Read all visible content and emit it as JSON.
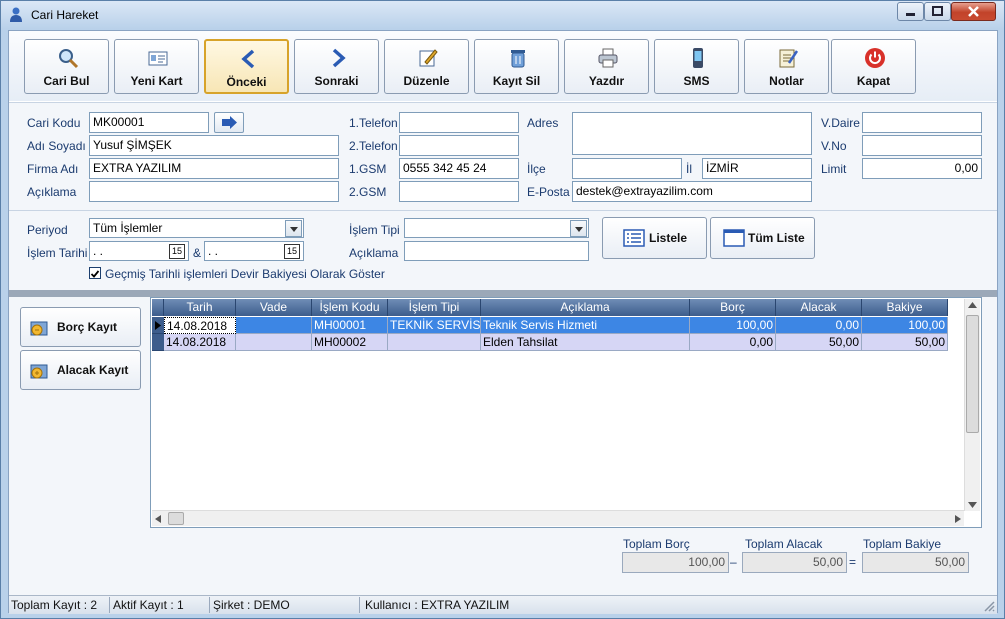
{
  "window": {
    "title": "Cari Hareket"
  },
  "colors": {
    "window_frame": "#b9d1ea",
    "grid_header": "#3d5d8c",
    "selected_row": "#3d86e4",
    "alt_row": "#d6d6f5",
    "active_button_border": "#d7a32a"
  },
  "toolbar": [
    {
      "label": "Cari Bul",
      "icon": "search-icon"
    },
    {
      "label": "Yeni Kart",
      "icon": "new-card-icon"
    },
    {
      "label": "Önceki",
      "icon": "previous-arrow-icon",
      "active": true
    },
    {
      "label": "Sonraki",
      "icon": "next-arrow-icon"
    },
    {
      "label": "Düzenle",
      "icon": "edit-icon"
    },
    {
      "label": "Kayıt Sil",
      "icon": "delete-icon"
    },
    {
      "label": "Yazdır",
      "icon": "printer-icon"
    },
    {
      "label": "SMS",
      "icon": "phone-icon"
    },
    {
      "label": "Notlar",
      "icon": "notes-icon"
    },
    {
      "label": "Kapat",
      "icon": "power-icon"
    }
  ],
  "info": {
    "cari_kodu": {
      "label": "Cari Kodu",
      "value": "MK00001"
    },
    "adi_soyadi": {
      "label": "Adı Soyadı",
      "value": "Yusuf ŞİMŞEK"
    },
    "firma_adi": {
      "label": "Firma Adı",
      "value": "EXTRA YAZILIM"
    },
    "aciklama": {
      "label": "Açıklama",
      "value": ""
    },
    "telefon1": {
      "label": "1.Telefon",
      "value": ""
    },
    "telefon2": {
      "label": "2.Telefon",
      "value": ""
    },
    "gsm1": {
      "label": "1.GSM",
      "value": "0555 342 45 24"
    },
    "gsm2": {
      "label": "2.GSM",
      "value": ""
    },
    "adres": {
      "label": "Adres",
      "value": ""
    },
    "ilce": {
      "label": "İlçe",
      "value": ""
    },
    "il": {
      "label": "İl",
      "value": "İZMİR"
    },
    "eposta": {
      "label": "E-Posta",
      "value": "destek@extrayazilim.com"
    },
    "vdaire": {
      "label": "V.Daire",
      "value": ""
    },
    "vno": {
      "label": "V.No",
      "value": ""
    },
    "limit": {
      "label": "Limit",
      "value": "0,00"
    }
  },
  "filter": {
    "periyod": {
      "label": "Periyod",
      "value": "Tüm İşlemler"
    },
    "islem_tarihi": {
      "label": "İşlem Tarihi",
      "from": " .  .",
      "to": " .  .",
      "separator": "&"
    },
    "islem_tipi": {
      "label": "İşlem Tipi",
      "value": ""
    },
    "aciklama": {
      "label": "Açıklama",
      "value": ""
    },
    "devir_checkbox": {
      "label": "Geçmiş Tarihli işlemleri Devir Bakiyesi Olarak Göster",
      "checked": true
    },
    "listele_label": "Listele",
    "tum_liste_label": "Tüm Liste"
  },
  "side_buttons": {
    "borc_kayit": "Borç Kayıt",
    "alacak_kayit": "Alacak Kayıt"
  },
  "grid": {
    "columns": [
      "Tarih",
      "Vade",
      "İşlem Kodu",
      "İşlem Tipi",
      "Açıklama",
      "Borç",
      "Alacak",
      "Bakiye"
    ],
    "rows": [
      {
        "tarih": "14.08.2018",
        "vade": "",
        "kod": "MH00001",
        "tip": "TEKNİK SERVİS",
        "aciklama": "Teknik Servis Hizmeti",
        "borc": "100,00",
        "alacak": "0,00",
        "bakiye": "100,00",
        "selected": true
      },
      {
        "tarih": "14.08.2018",
        "vade": "",
        "kod": "MH00002",
        "tip": "",
        "aciklama": "Elden Tahsilat",
        "borc": "0,00",
        "alacak": "50,00",
        "bakiye": "50,00",
        "selected": false
      }
    ]
  },
  "totals": {
    "borc": {
      "label": "Toplam Borç",
      "value": "100,00"
    },
    "alacak": {
      "label": "Toplam Alacak",
      "value": "50,00"
    },
    "bakiye": {
      "label": "Toplam Bakiye",
      "value": "50,00"
    },
    "minus": "–",
    "equals": "="
  },
  "status": {
    "toplam_kayit": "Toplam Kayıt : 2",
    "aktif_kayit": "Aktif Kayıt : 1",
    "sirket": "Şirket : DEMO",
    "kullanici": "Kullanıcı : EXTRA YAZILIM"
  }
}
